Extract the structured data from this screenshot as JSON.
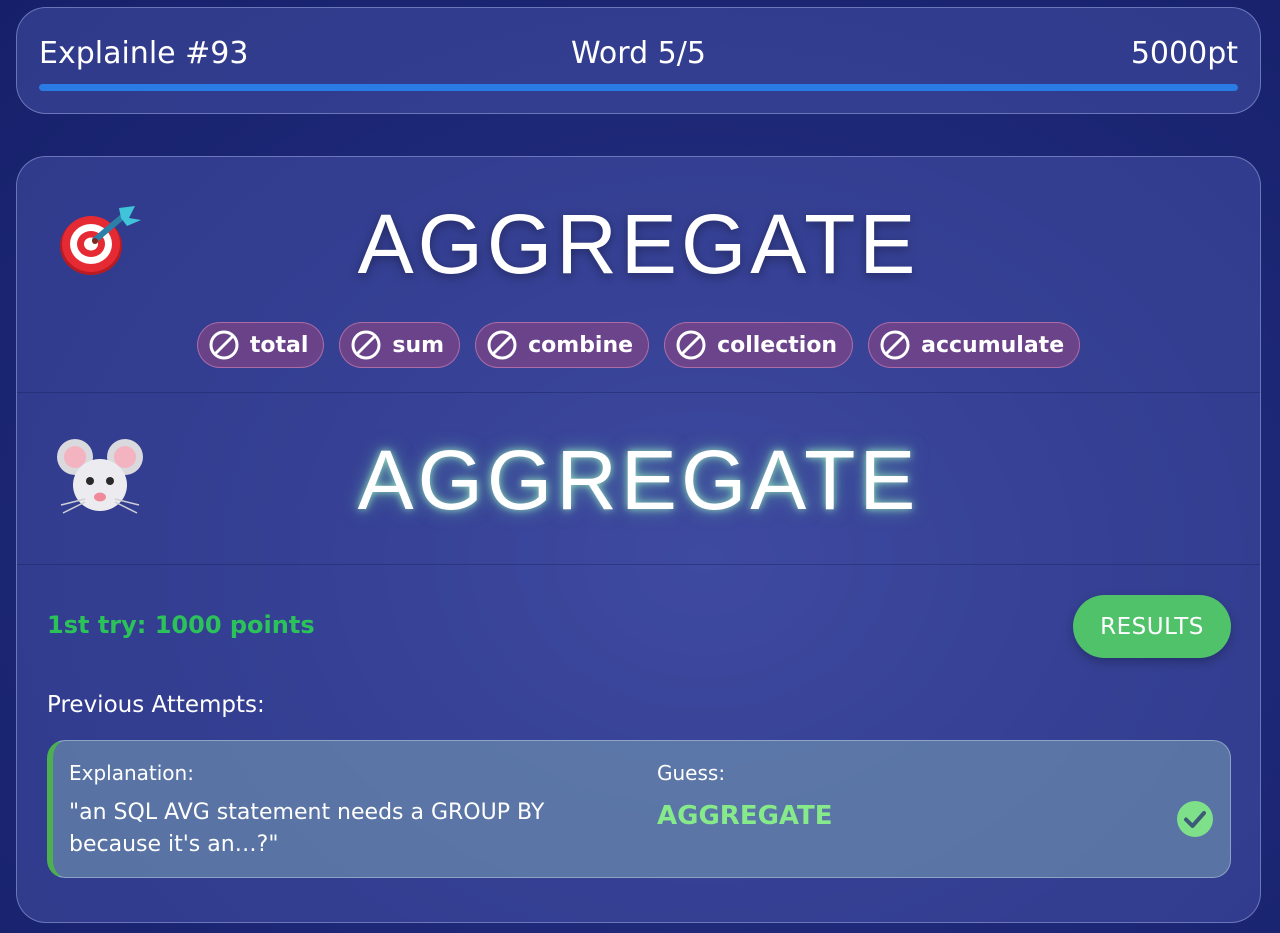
{
  "header": {
    "title": "Explainle #93",
    "word_progress": "Word 5/5",
    "score": "5000pt",
    "progress": 1.0,
    "progress_color": "#2a7be4"
  },
  "target": {
    "icon": "target-dart-icon",
    "word": "AGGREGATE",
    "taboo_words": [
      "total",
      "sum",
      "combine",
      "collection",
      "accumulate"
    ]
  },
  "guesser": {
    "icon": "mouse-face-icon",
    "word": "AGGREGATE"
  },
  "result": {
    "text": "1st try: 1000 points",
    "color": "#2cc25a",
    "results_button": "RESULTS"
  },
  "previous": {
    "label": "Previous Attempts:",
    "attempts": [
      {
        "explanation_label": "Explanation:",
        "explanation": "\"an SQL AVG statement needs a GROUP BY because it's an…?\"",
        "guess_label": "Guess:",
        "guess": "AGGREGATE",
        "status_icon": "check-circle-icon"
      }
    ]
  }
}
